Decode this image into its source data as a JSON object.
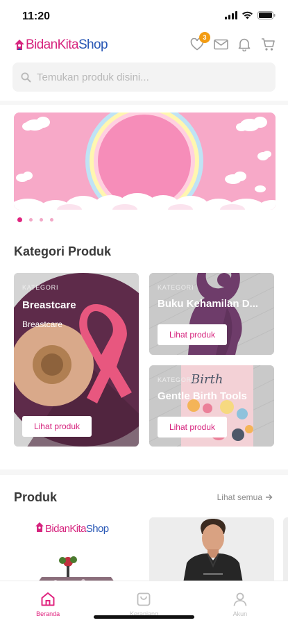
{
  "status_bar": {
    "time": "11:20"
  },
  "header": {
    "logo_part1": "Bidan",
    "logo_part2": "Kita",
    "logo_part3": "Shop",
    "wishlist_count": "3"
  },
  "search": {
    "placeholder": "Temukan produk disini..."
  },
  "banner": {
    "slide_count": 4,
    "active_slide": 1
  },
  "categories": {
    "title": "Kategori Produk",
    "items": [
      {
        "kicker": "KATEGORI",
        "name": "Breastcare",
        "subtitle": "Breastcare",
        "button": "Lihat produk"
      },
      {
        "kicker": "KATEGORI",
        "name": "Buku Kehamilan D...",
        "button": "Lihat produk"
      },
      {
        "kicker": "KATEGORI",
        "name": "Gentle Birth Tools",
        "button": "Lihat produk"
      }
    ]
  },
  "products": {
    "title": "Produk",
    "see_all": "Lihat semua",
    "card1_logo_part1": "Bidan",
    "card1_logo_part2": "Kita",
    "card1_logo_part3": "Shop"
  },
  "bottom_nav": {
    "items": [
      {
        "label": "Beranda",
        "icon": "home-icon",
        "active": true
      },
      {
        "label": "Keranjang",
        "icon": "bag-icon",
        "active": false
      },
      {
        "label": "Akun",
        "icon": "user-icon",
        "active": false
      }
    ]
  },
  "colors": {
    "brand_pink": "#e0247f",
    "brand_blue": "#2857b5",
    "badge_orange": "#f39c12"
  }
}
